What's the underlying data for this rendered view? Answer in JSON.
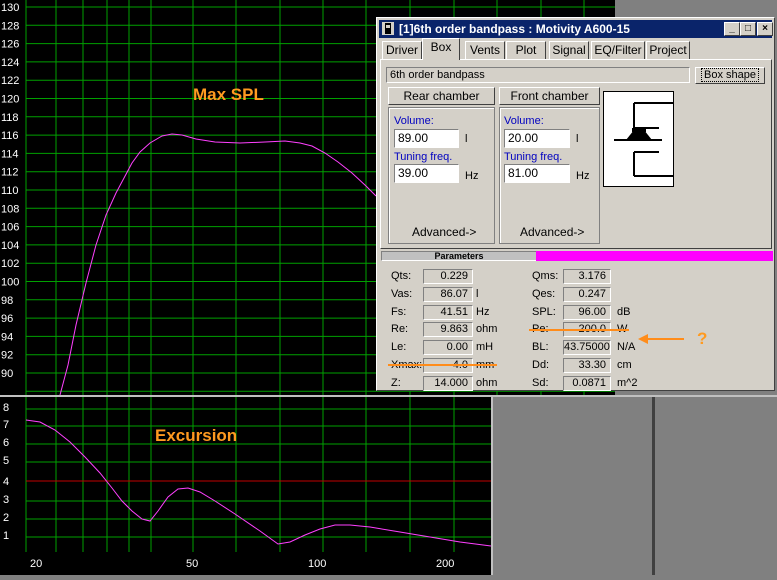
{
  "spl_plot": {
    "annotation": "Max SPL",
    "y_ticks": [
      "130",
      "128",
      "126",
      "124",
      "122",
      "120",
      "118",
      "116",
      "114",
      "112",
      "110",
      "108",
      "106",
      "104",
      "102",
      "100",
      "98",
      "96",
      "94",
      "92",
      "90"
    ]
  },
  "excursion_plot": {
    "annotation": "Excursion",
    "y_ticks": [
      "8",
      "7",
      "6",
      "5",
      "4",
      "3",
      "2",
      "1"
    ],
    "x_ticks": [
      "20",
      "50",
      "100",
      "200"
    ]
  },
  "dialog": {
    "title": "[1]6th order bandpass : Motivity A600-15",
    "tabs": [
      "Driver",
      "Box",
      "Vents",
      "Plot",
      "Signal",
      "EQ/Filter",
      "Project"
    ],
    "active_tab": "Box",
    "box_name": "6th order bandpass",
    "box_shape_button": "Box shape",
    "rear": {
      "button": "Rear chamber",
      "volume_label": "Volume:",
      "volume": "89.00",
      "volume_unit": "l",
      "tuning_label": "Tuning freq.",
      "tuning": "39.00",
      "tuning_unit": "Hz",
      "advanced": "Advanced->"
    },
    "front": {
      "button": "Front chamber",
      "volume_label": "Volume:",
      "volume": "20.00",
      "volume_unit": "l",
      "tuning_label": "Tuning freq.",
      "tuning": "81.00",
      "tuning_unit": "Hz",
      "advanced": "Advanced->"
    },
    "parameters_label": "Parameters",
    "params_left": [
      {
        "label": "Qts:",
        "value": "0.229",
        "unit": ""
      },
      {
        "label": "Vas:",
        "value": "86.07",
        "unit": "l"
      },
      {
        "label": "Fs:",
        "value": "41.51",
        "unit": "Hz"
      },
      {
        "label": "Re:",
        "value": "9.863",
        "unit": "ohm"
      },
      {
        "label": "Le:",
        "value": "0.00",
        "unit": "mH"
      },
      {
        "label": "Xmax:",
        "value": "4.0",
        "unit": "mm"
      },
      {
        "label": "Z:",
        "value": "14.000",
        "unit": "ohm"
      }
    ],
    "params_right": [
      {
        "label": "Qms:",
        "value": "3.176",
        "unit": ""
      },
      {
        "label": "Qes:",
        "value": "0.247",
        "unit": ""
      },
      {
        "label": "SPL:",
        "value": "96.00",
        "unit": "dB"
      },
      {
        "label": "Pe:",
        "value": "200.0",
        "unit": "W"
      },
      {
        "label": "BL:",
        "value": "43.75000",
        "unit": "N/A"
      },
      {
        "label": "Dd:",
        "value": "33.30",
        "unit": "cm"
      },
      {
        "label": "Sd:",
        "value": "0.0871",
        "unit": "m^2"
      }
    ]
  },
  "question_mark": "?",
  "colors": {
    "grid": "#00a000",
    "curve": "#ff40ff",
    "limit": "#c00000",
    "annotation": "#ff9a20",
    "titlebar": "#0a246a",
    "magenta_bar": "#ff00ff"
  }
}
